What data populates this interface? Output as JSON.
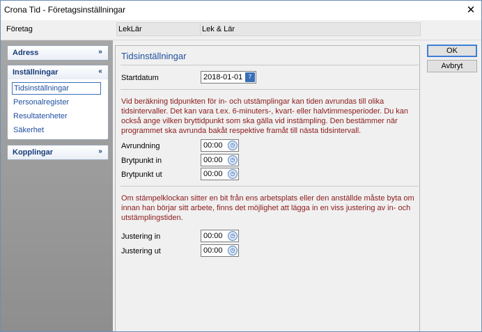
{
  "window": {
    "title": "Crona Tid - Företagsinställningar"
  },
  "company": {
    "label": "Företag",
    "code": "LekLär",
    "name": "Lek & Lär"
  },
  "sidebar": {
    "panels": [
      {
        "title": "Adress",
        "toggle": "»"
      },
      {
        "title": "Inställningar",
        "toggle": "«",
        "items": [
          "Tidsinställningar",
          "Personalregister",
          "Resultatenheter",
          "Säkerhet"
        ]
      },
      {
        "title": "Kopplingar",
        "toggle": "»"
      }
    ]
  },
  "main": {
    "title": "Tidsinställningar",
    "start_date": {
      "label": "Startdatum",
      "value": "2018-01-01",
      "icon": "calendar-icon"
    },
    "info1": "Vid beräkning tidpunkten för in- och utstämplingar kan tiden avrundas till olika tidsintervaller. Det kan vara t.ex. 6-minuters-, kvart- eller halvtimmesperioder. Du kan också ange vilken bryttidpunkt som ska gälla vid instämpling. Den bestämmer när programmet ska avrunda bakåt respektive framåt till nästa tidsintervall.",
    "rounding": {
      "label": "Avrundning",
      "value": "00:00"
    },
    "break_in": {
      "label": "Brytpunkt in",
      "value": "00:00"
    },
    "break_out": {
      "label": "Brytpunkt ut",
      "value": "00:00"
    },
    "info2": "Om stämpelklockan sitter en bit från ens arbetsplats eller den anställde måste byta om innan han börjar sitt arbete, finns det möjlighet att lägga in en viss justering av in- och utstämplingstiden.",
    "adjust_in": {
      "label": "Justering in",
      "value": "00:00"
    },
    "adjust_out": {
      "label": "Justering ut",
      "value": "00:00"
    }
  },
  "buttons": {
    "ok": "OK",
    "cancel": "Avbryt"
  },
  "colors": {
    "panel_title": "#163b7a",
    "link": "#1f4fa0",
    "info_text": "#8b1a1a"
  }
}
